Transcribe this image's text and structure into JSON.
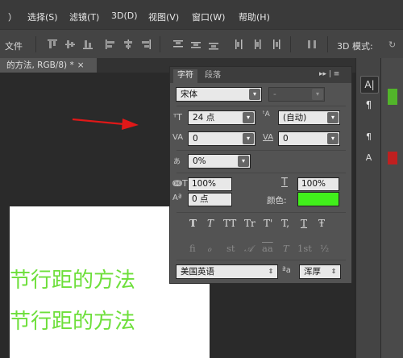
{
  "menubar": {
    "items": [
      "）",
      "选择(S)",
      "滤镜(T)",
      "3D(D)",
      "视图(V)",
      "窗口(W)",
      "帮助(H)"
    ]
  },
  "optionsbar": {
    "left_label": "文件",
    "mode_label": "3D 模式:"
  },
  "document": {
    "tab_label": "的方法, RGB/8) *",
    "close": "×",
    "text_line1": "节行距的方法",
    "text_line2": "节行距的方法",
    "text_color": "#6ddf3a"
  },
  "panel": {
    "tab_character": "字符",
    "tab_paragraph": "段落",
    "menu_icon": "▸▸ | ≡",
    "font_family": "宋体",
    "font_style": "-",
    "font_size": "24 点",
    "leading": "(自动)",
    "kerning": "0",
    "tracking": "0",
    "tsume": "0%",
    "vertical_scale": "100%",
    "horizontal_scale": "100%",
    "baseline_shift": "0 点",
    "color_label": "颜色:",
    "color_value": "#41ef1b",
    "language": "美国英语",
    "aa_label": "ªa",
    "antialias": "浑厚",
    "type_buttons": [
      "T",
      "T",
      "TT",
      "Tr",
      "T'",
      "T,",
      "T",
      "Ŧ"
    ],
    "opentype_buttons": [
      "fi",
      "ℴ",
      "st",
      "𝒜",
      "aa",
      "T",
      "1st",
      "½"
    ]
  },
  "dock": {
    "items": [
      "A|",
      "¶",
      "",
      "¶",
      "A"
    ]
  }
}
